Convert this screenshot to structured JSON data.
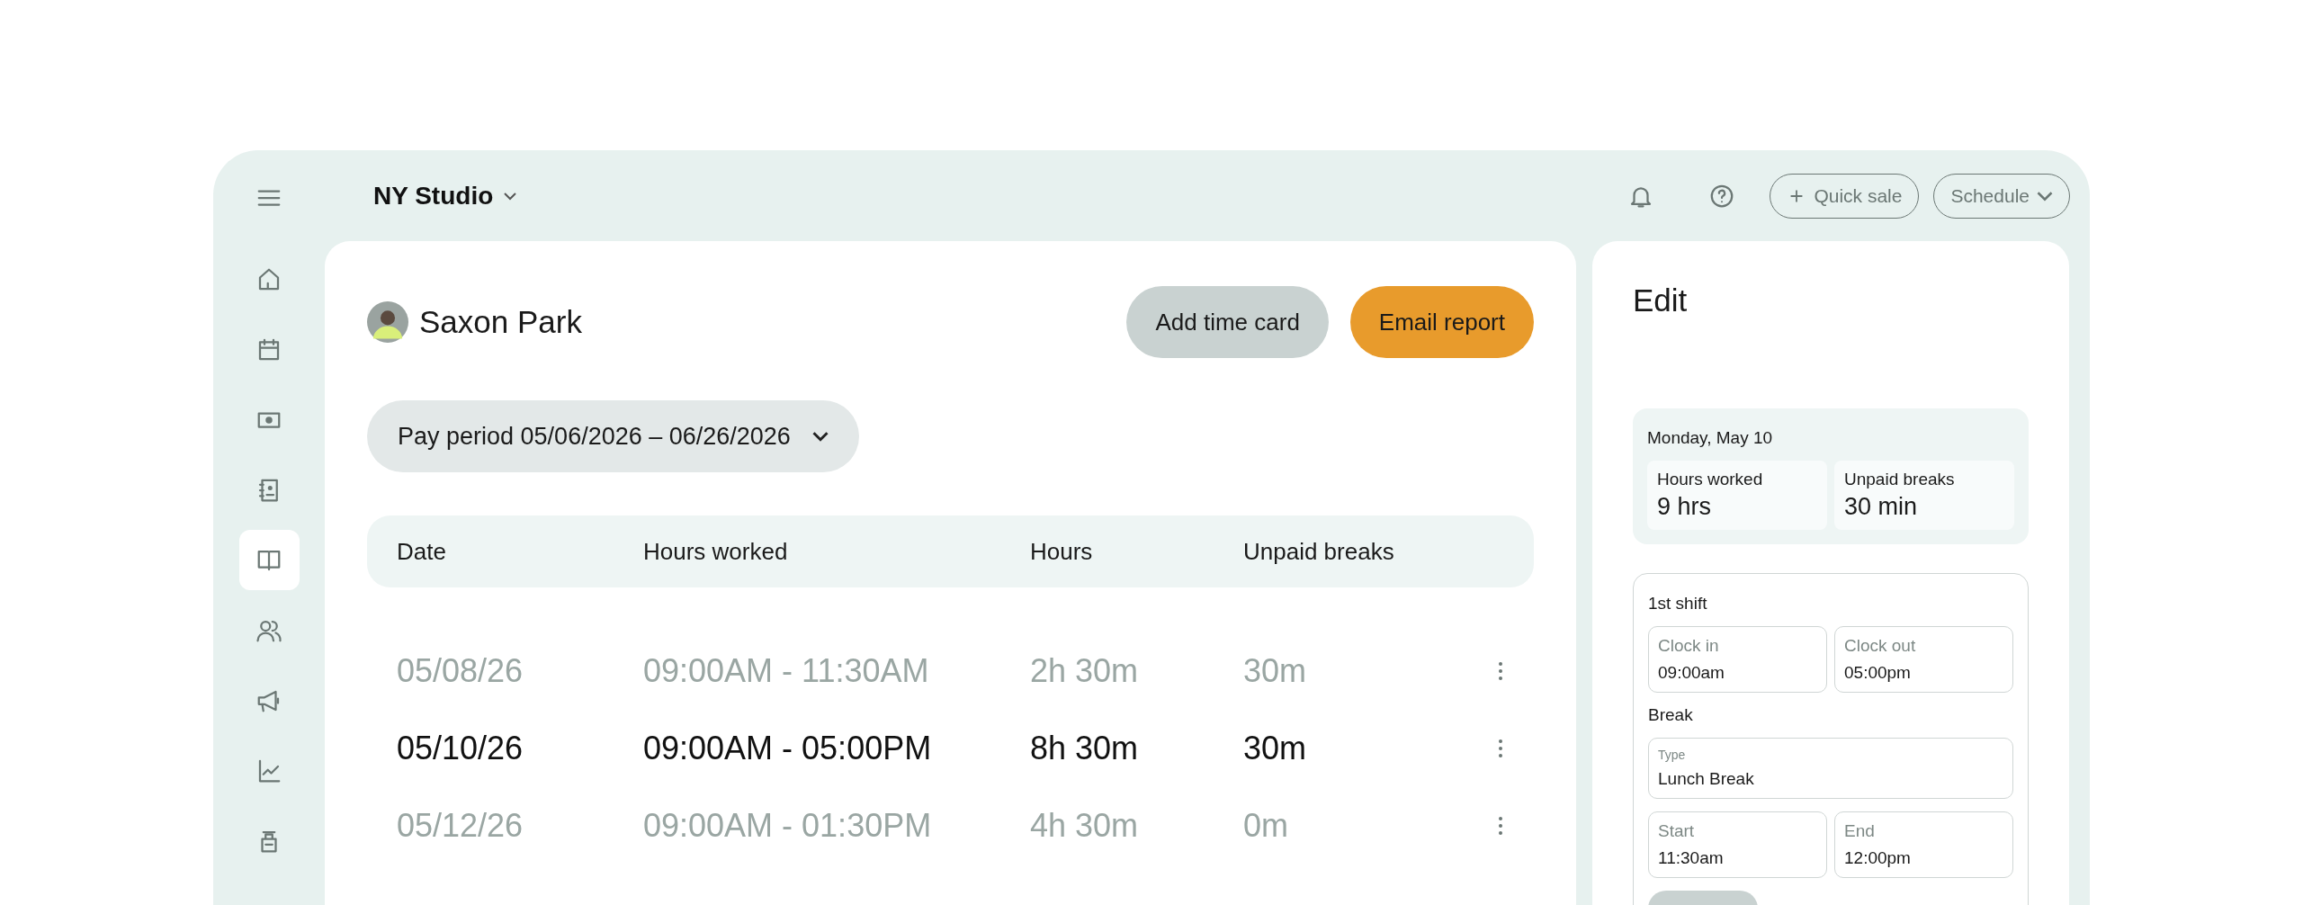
{
  "header": {
    "location": "NY Studio",
    "quick_sale": "Quick sale",
    "schedule": "Schedule"
  },
  "sidebar": {
    "items": [
      {
        "selected": false
      },
      {
        "selected": false
      },
      {
        "selected": false
      },
      {
        "selected": false
      },
      {
        "selected": true
      },
      {
        "selected": false
      },
      {
        "selected": false
      },
      {
        "selected": false
      },
      {
        "selected": false
      }
    ]
  },
  "employee": {
    "name": "Saxon Park"
  },
  "actions": {
    "add": "Add time card",
    "email": "Email report"
  },
  "pay_period": "Pay period 05/06/2026 – 06/26/2026",
  "table": {
    "columns": [
      "Date",
      "Hours worked",
      "Hours",
      "Unpaid breaks"
    ],
    "rows": [
      {
        "date": "05/08/26",
        "range": "09:00AM - 11:30AM",
        "hours": "2h 30m",
        "breaks": "30m",
        "selected": false
      },
      {
        "date": "05/10/26",
        "range": "09:00AM - 05:00PM",
        "hours": "8h 30m",
        "breaks": "30m",
        "selected": true
      },
      {
        "date": "05/12/26",
        "range": "09:00AM - 01:30PM",
        "hours": "4h 30m",
        "breaks": "0m",
        "selected": false
      }
    ]
  },
  "edit": {
    "title": "Edit",
    "day": "Monday, May 10",
    "stats": [
      {
        "label": "Hours worked",
        "value": "9 hrs"
      },
      {
        "label": "Unpaid breaks",
        "value": "30 min"
      }
    ],
    "shift_title": "1st shift",
    "clock": [
      {
        "label": "Clock in",
        "value": "09:00am"
      },
      {
        "label": "Clock out",
        "value": "05:00pm"
      }
    ],
    "break_title": "Break",
    "break_type": {
      "label": "Type",
      "value": "Lunch Break"
    },
    "break_times": [
      {
        "label": "Start",
        "value": "11:30am"
      },
      {
        "label": "End",
        "value": "12:00pm"
      }
    ]
  }
}
